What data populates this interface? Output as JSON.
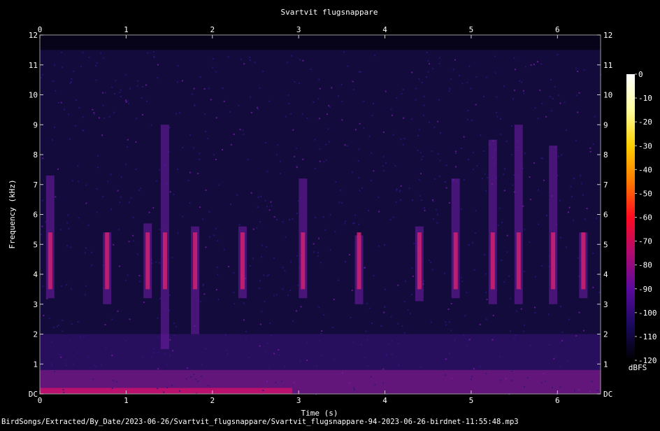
{
  "chart_data": {
    "type": "heatmap",
    "title": "Svartvit flugsnappare",
    "xlabel": "Time (s)",
    "ylabel": "Frequency (kHz)",
    "xlim": [
      0,
      6.5
    ],
    "ylim": [
      0,
      12
    ],
    "x_ticks": [
      "0",
      "1",
      "2",
      "3",
      "4",
      "5",
      "6"
    ],
    "y_ticks": [
      "DC",
      "1",
      "2",
      "3",
      "4",
      "5",
      "6",
      "7",
      "8",
      "9",
      "10",
      "11",
      "12"
    ],
    "colorbar": {
      "label": "dBFS",
      "range": [
        -120,
        0
      ],
      "ticks": [
        "0",
        "-10",
        "-20",
        "-30",
        "-40",
        "-50",
        "-60",
        "-70",
        "-80",
        "-90",
        "-100",
        "-110",
        "-120"
      ],
      "colors": [
        "#000000",
        "#1a0a5e",
        "#5a0a9e",
        "#b00a70",
        "#ff0a20",
        "#ff7a00",
        "#ffd000",
        "#ffff9f",
        "#ffffff"
      ]
    },
    "grid": false
  },
  "footer": {
    "filename": "BirdSongs/Extracted/By_Date/2023-06-26/Svartvit_flugsnappare/Svartvit_flugsnappare-94-2023-06-26-birdnet-11:55:48.mp3"
  }
}
